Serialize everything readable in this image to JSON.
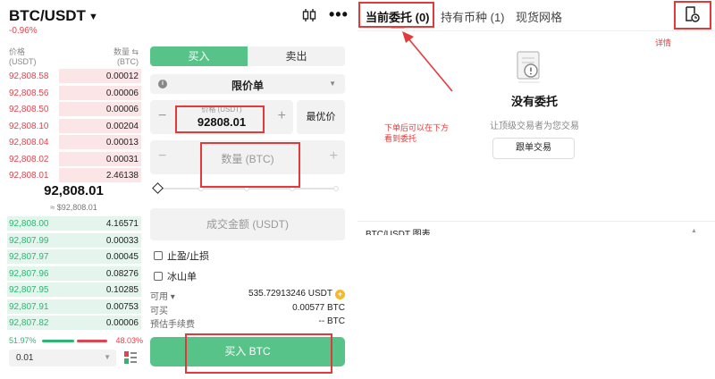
{
  "header": {
    "pair": "BTC/USDT",
    "change": "-0.96%",
    "candle_icon": "candlestick-icon",
    "more_icon": "more-icon",
    "more_glyph": "•••"
  },
  "orderbook": {
    "price_header": "价格\n(USDT)",
    "qty_header": "数量 ⇆\n(BTC)",
    "asks": [
      {
        "price": "92,808.58",
        "qty": "0.00012"
      },
      {
        "price": "92,808.56",
        "qty": "0.00006"
      },
      {
        "price": "92,808.50",
        "qty": "0.00006"
      },
      {
        "price": "92,808.10",
        "qty": "0.00204"
      },
      {
        "price": "92,808.04",
        "qty": "0.00013"
      },
      {
        "price": "92,808.02",
        "qty": "0.00031"
      },
      {
        "price": "92,808.01",
        "qty": "2.46138"
      }
    ],
    "last_price": "92,808.01",
    "last_fiat": "≈ $92,808.01",
    "bids": [
      {
        "price": "92,808.00",
        "qty": "4.16571"
      },
      {
        "price": "92,807.99",
        "qty": "0.00033"
      },
      {
        "price": "92,807.97",
        "qty": "0.00045"
      },
      {
        "price": "92,807.96",
        "qty": "0.08276"
      },
      {
        "price": "92,807.95",
        "qty": "0.10285"
      },
      {
        "price": "92,807.91",
        "qty": "0.00753"
      },
      {
        "price": "92,807.82",
        "qty": "0.00006"
      }
    ],
    "buy_ratio": "51.97%",
    "sell_ratio": "48.03%",
    "depth_value": "0.01"
  },
  "trade": {
    "tab_buy": "买入",
    "tab_sell": "卖出",
    "order_type": "限价单",
    "price_label": "价格 (USDT)",
    "price_value": "92808.01",
    "best_price": "最优价",
    "qty_placeholder": "数量 (BTC)",
    "amount_placeholder": "成交金额 (USDT)",
    "tpsl": "止盈/止损",
    "iceberg": "冰山单",
    "available_label": "可用 ▾",
    "available_value": "535.72913246 USDT",
    "buyable_label": "可买",
    "buyable_value": "0.00577 BTC",
    "fee_label": "预估手续费",
    "fee_value": "-- BTC",
    "buy_button": "买入 BTC"
  },
  "orders_panel": {
    "tab_open": "当前委托 (0)",
    "tab_hold": "持有币种 (1)",
    "tab_grid": "现货网格",
    "empty_title": "没有委托",
    "empty_sub": "让顶级交易者为您交易",
    "copy_button": "跟单交易",
    "chart_section": "BTC/USDT 图表"
  },
  "annotations": {
    "details": "详情",
    "hint": "下单后可以在下方\n看到委托"
  },
  "colors": {
    "buy": "#58c389",
    "bid_text": "#2fb572",
    "ask_text": "#e0454f",
    "annotation": "#e23a3a",
    "accent": "#f5b829"
  }
}
